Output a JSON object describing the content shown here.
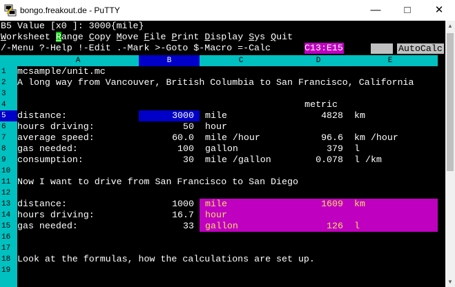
{
  "window": {
    "title": "bongo.freakout.de - PuTTY"
  },
  "status_line": "B5 Value [x0 ]: 3000{mile}",
  "menu": {
    "items": [
      {
        "pre": "",
        "u": "W",
        "rest": "orksheet"
      },
      {
        "pre": "",
        "u": "R",
        "rest": "ange"
      },
      {
        "pre": "",
        "u": "C",
        "rest": "opy"
      },
      {
        "pre": "",
        "u": "M",
        "rest": "ove"
      },
      {
        "pre": "",
        "u": "F",
        "rest": "ile"
      },
      {
        "pre": "",
        "u": "P",
        "rest": "rint"
      },
      {
        "pre": "",
        "u": "D",
        "rest": "isplay"
      },
      {
        "pre": "",
        "u": "S",
        "rest": "ys"
      },
      {
        "pre": "",
        "u": "Q",
        "rest": "uit"
      }
    ]
  },
  "help_line": "/-Menu ?-Help !-Edit .-Mark >-Goto $-Macro =-Calc",
  "range_badge": "C13:E15",
  "autocalc_label": "AutoCalc",
  "columns": [
    "A",
    "B",
    "C",
    "D",
    "E"
  ],
  "rows": [
    {
      "n": "1",
      "a": "mcsample/unit.mc"
    },
    {
      "n": "2",
      "a": "A long way from Vancouver, British Columbia to San Francisco, California"
    },
    {
      "n": "3"
    },
    {
      "n": "4",
      "d": "metric"
    },
    {
      "n": "5",
      "a": "distance:",
      "b": "3000",
      "c": "mile",
      "d": "4828",
      "e": "km"
    },
    {
      "n": "6",
      "a": "hours driving:",
      "b": "50",
      "c": "hour"
    },
    {
      "n": "7",
      "a": "average speed:",
      "b": "60.0",
      "c": "mile /hour",
      "d": "96.6",
      "e": "km /hour"
    },
    {
      "n": "8",
      "a": "gas needed:",
      "b": "100",
      "c": "gallon",
      "d": "379",
      "e": "l"
    },
    {
      "n": "9",
      "a": "consumption:",
      "b": "30",
      "c": "mile /gallon",
      "d": "0.078",
      "e": "l /km"
    },
    {
      "n": "10"
    },
    {
      "n": "11",
      "a": "Now I want to drive from San Francisco to San Diego"
    },
    {
      "n": "12"
    },
    {
      "n": "13",
      "a": "distance:",
      "b": "1000",
      "c": "mile",
      "d": "1609",
      "e": "km"
    },
    {
      "n": "14",
      "a": "hours driving:",
      "b": "16.7",
      "c": "hour"
    },
    {
      "n": "15",
      "a": "gas needed:",
      "b": "33",
      "c": "gallon",
      "d": "126",
      "e": "l"
    },
    {
      "n": "16"
    },
    {
      "n": "17"
    },
    {
      "n": "18",
      "a": "Look at the formulas, how the calculations are set up."
    },
    {
      "n": "19"
    }
  ],
  "colors": {
    "header_bg": "#00c0c0",
    "cursor_bg": "#0000c8",
    "range_bg": "#c000c0",
    "range_fg": "#f0e060"
  }
}
